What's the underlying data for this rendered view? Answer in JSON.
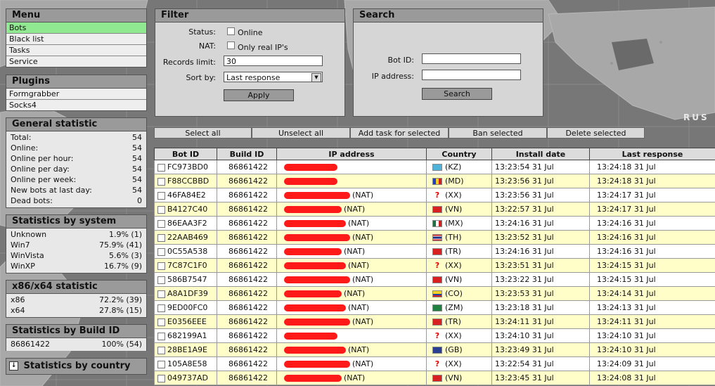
{
  "menu": {
    "title": "Menu",
    "items": [
      "Bots",
      "Black list",
      "Tasks",
      "Service"
    ]
  },
  "plugins": {
    "title": "Plugins",
    "items": [
      "Formgrabber",
      "Socks4"
    ]
  },
  "general_statistic": {
    "title": "General statistic",
    "rows": [
      {
        "label": "Total:",
        "value": "54"
      },
      {
        "label": "Online:",
        "value": "54"
      },
      {
        "label": "Online per hour:",
        "value": "54"
      },
      {
        "label": "Online per day:",
        "value": "54"
      },
      {
        "label": "Online per week:",
        "value": "54"
      },
      {
        "label": "New bots at last day:",
        "value": "54"
      },
      {
        "label": "Dead bots:",
        "value": "0"
      }
    ]
  },
  "stats_system": {
    "title": "Statistics by system",
    "rows": [
      {
        "label": "Unknown",
        "value": "1.9% (1)"
      },
      {
        "label": "Win7",
        "value": "75.9% (41)"
      },
      {
        "label": "WinVista",
        "value": "5.6% (3)"
      },
      {
        "label": "WinXP",
        "value": "16.7% (9)"
      }
    ]
  },
  "stats_arch": {
    "title": "x86/x64 statistic",
    "rows": [
      {
        "label": "x86",
        "value": "72.2% (39)"
      },
      {
        "label": "x64",
        "value": "27.8% (15)"
      }
    ]
  },
  "stats_build": {
    "title": "Statistics by Build ID",
    "rows": [
      {
        "label": "86861422",
        "value": "100% (54)"
      }
    ]
  },
  "stats_country": {
    "title": "Statistics by country",
    "icon": "expand-arrow-icon"
  },
  "filter": {
    "title": "Filter",
    "status_label": "Status:",
    "online_label": "Online",
    "nat_label": "NAT:",
    "only_real_label": "Only real IP's",
    "records_label": "Records limit:",
    "records_value": "30",
    "sort_label": "Sort by:",
    "sort_value": "Last response",
    "apply_label": "Apply"
  },
  "search": {
    "title": "Search",
    "bot_id_label": "Bot ID:",
    "ip_label": "IP address:",
    "search_label": "Search"
  },
  "actions": {
    "select_all": "Select all",
    "unselect_all": "Unselect all",
    "add_task": "Add task for selected",
    "ban": "Ban selected",
    "delete": "Delete selected"
  },
  "map_label": "RUS",
  "table": {
    "headers": [
      "Bot ID",
      "Build ID",
      "IP address",
      "Country",
      "Install date",
      "Last response"
    ],
    "rows": [
      {
        "bot_id": "FC973BD0",
        "build": "86861422",
        "nat": "",
        "country": "(KZ)",
        "flag": "kz",
        "install": "13:23:54 31 Jul",
        "last": "13:24:18 31 Jul"
      },
      {
        "bot_id": "F88CCBBD",
        "build": "86861422",
        "nat": "",
        "country": "(MD)",
        "flag": "md",
        "install": "13:23:56 31 Jul",
        "last": "13:24:18 31 Jul"
      },
      {
        "bot_id": "46FA84E2",
        "build": "86861422",
        "nat": "(NAT)",
        "country": "(XX)",
        "flag": "xx",
        "install": "13:23:56 31 Jul",
        "last": "13:24:17 31 Jul"
      },
      {
        "bot_id": "B4127C40",
        "build": "86861422",
        "nat": "(NAT)",
        "country": "(VN)",
        "flag": "vn",
        "install": "13:22:57 31 Jul",
        "last": "13:24:17 31 Jul"
      },
      {
        "bot_id": "86EAA3F2",
        "build": "86861422",
        "nat": "(NAT)",
        "country": "(MX)",
        "flag": "mx",
        "install": "13:24:16 31 Jul",
        "last": "13:24:16 31 Jul"
      },
      {
        "bot_id": "22AAB469",
        "build": "86861422",
        "nat": "(NAT)",
        "country": "(TH)",
        "flag": "th",
        "install": "13:23:52 31 Jul",
        "last": "13:24:16 31 Jul"
      },
      {
        "bot_id": "0C55A538",
        "build": "86861422",
        "nat": "(NAT)",
        "country": "(TR)",
        "flag": "tr",
        "install": "13:24:16 31 Jul",
        "last": "13:24:16 31 Jul"
      },
      {
        "bot_id": "7C87C1F0",
        "build": "86861422",
        "nat": "(NAT)",
        "country": "(XX)",
        "flag": "xx",
        "install": "13:23:51 31 Jul",
        "last": "13:24:15 31 Jul"
      },
      {
        "bot_id": "586B7547",
        "build": "86861422",
        "nat": "(NAT)",
        "country": "(VN)",
        "flag": "vn",
        "install": "13:23:22 31 Jul",
        "last": "13:24:15 31 Jul"
      },
      {
        "bot_id": "A8A1DF39",
        "build": "86861422",
        "nat": "(NAT)",
        "country": "(CO)",
        "flag": "co",
        "install": "13:23:53 31 Jul",
        "last": "13:24:14 31 Jul"
      },
      {
        "bot_id": "9ED00FC0",
        "build": "86861422",
        "nat": "(NAT)",
        "country": "(ZM)",
        "flag": "zm",
        "install": "13:23:18 31 Jul",
        "last": "13:24:13 31 Jul"
      },
      {
        "bot_id": "E0356EEE",
        "build": "86861422",
        "nat": "(NAT)",
        "country": "(TR)",
        "flag": "tr",
        "install": "13:24:11 31 Jul",
        "last": "13:24:11 31 Jul"
      },
      {
        "bot_id": "682199A1",
        "build": "86861422",
        "nat": "",
        "country": "(XX)",
        "flag": "xx",
        "install": "13:24:10 31 Jul",
        "last": "13:24:10 31 Jul"
      },
      {
        "bot_id": "28BE1A9E",
        "build": "86861422",
        "nat": "(NAT)",
        "country": "(GB)",
        "flag": "gb",
        "install": "13:23:49 31 Jul",
        "last": "13:24:10 31 Jul"
      },
      {
        "bot_id": "105A8E58",
        "build": "86861422",
        "nat": "(NAT)",
        "country": "(XX)",
        "flag": "xx",
        "install": "13:22:54 31 Jul",
        "last": "13:24:09 31 Jul"
      },
      {
        "bot_id": "049737AD",
        "build": "86861422",
        "nat": "(NAT)",
        "country": "(VN)",
        "flag": "vn",
        "install": "13:23:45 31 Jul",
        "last": "13:24:08 31 Jul"
      }
    ]
  }
}
